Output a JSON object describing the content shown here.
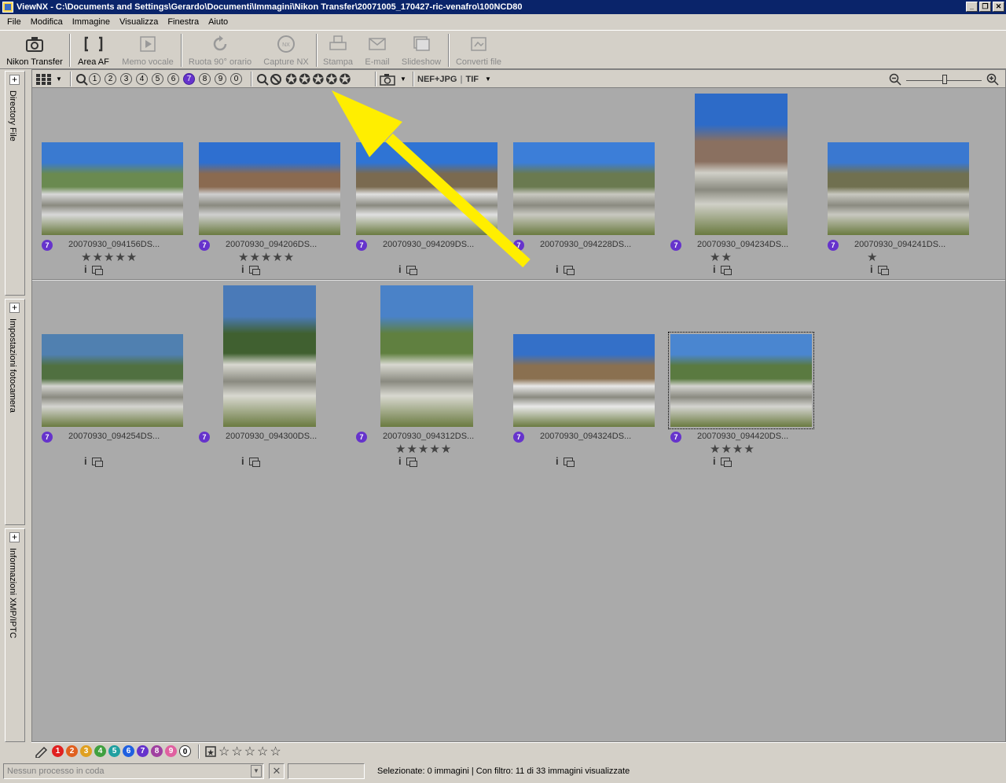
{
  "window": {
    "title": "ViewNX - C:\\Documents and Settings\\Gerardo\\Documenti\\Immagini\\Nikon Transfer\\20071005_170427-ric-venafro\\100NCD80",
    "min": "_",
    "max": "❐",
    "close": "✕"
  },
  "menu": [
    "File",
    "Modifica",
    "Immagine",
    "Visualizza",
    "Finestra",
    "Aiuto"
  ],
  "toolbar": {
    "nikon_transfer": "Nikon Transfer",
    "area_af": "Area AF",
    "memo_vocale": "Memo vocale",
    "ruota": "Ruota 90° orario",
    "capture_nx": "Capture NX",
    "stampa": "Stampa",
    "email": "E-mail",
    "slideshow": "Slideshow",
    "converti": "Converti file"
  },
  "side_panels": [
    "Directory File",
    "Impostazioni fotocamera",
    "Informazioni XMP/IPTC"
  ],
  "view_toolbar": {
    "label_filters": [
      "1",
      "2",
      "3",
      "4",
      "5",
      "6",
      "7",
      "8",
      "9",
      "0"
    ],
    "active_label": "7",
    "format_filter": "NEF+JPG",
    "format_sep": "|",
    "format_tif": "TIF"
  },
  "thumbnails": [
    {
      "name": "20070930_094156DS...",
      "label": "7",
      "stars": "★★★★★",
      "info": "i"
    },
    {
      "name": "20070930_094206DS...",
      "label": "7",
      "stars": "★★★★★",
      "info": "i"
    },
    {
      "name": "20070930_094209DS...",
      "label": "7",
      "stars": "",
      "info": "i"
    },
    {
      "name": "20070930_094228DS...",
      "label": "7",
      "stars": "",
      "info": "i"
    },
    {
      "name": "20070930_094234DS...",
      "label": "7",
      "stars": "★★",
      "info": "i"
    },
    {
      "name": "20070930_094241DS...",
      "label": "7",
      "stars": "★",
      "info": "i"
    },
    {
      "name": "20070930_094254DS...",
      "label": "7",
      "stars": "",
      "info": "i"
    },
    {
      "name": "20070930_094300DS...",
      "label": "7",
      "stars": "",
      "info": "i"
    },
    {
      "name": "20070930_094312DS...",
      "label": "7",
      "stars": "★★★★★",
      "info": "i"
    },
    {
      "name": "20070930_094324DS...",
      "label": "7",
      "stars": "",
      "info": "i"
    },
    {
      "name": "20070930_094420DS...",
      "label": "7",
      "stars": "★★★★",
      "info": "i"
    }
  ],
  "label_bar": {
    "labels": [
      "1",
      "2",
      "3",
      "4",
      "5",
      "6",
      "7",
      "8",
      "9",
      "0"
    ],
    "label_colors": [
      "#e02020",
      "#e06020",
      "#e0a020",
      "#40a040",
      "#20a0a0",
      "#2060e0",
      "#6633cc",
      "#a040a0",
      "#e060a0",
      "#ffffff"
    ],
    "rating_stars": "☆☆☆☆☆"
  },
  "status": {
    "queue": "Nessun processo in coda",
    "selection": "Selezionate: 0 immagini | Con filtro: 11 di 33 immagini visualizzate"
  },
  "colors": {
    "titlebar": "#0a246a",
    "label7": "#6633cc",
    "arrow": "#ffee00"
  }
}
